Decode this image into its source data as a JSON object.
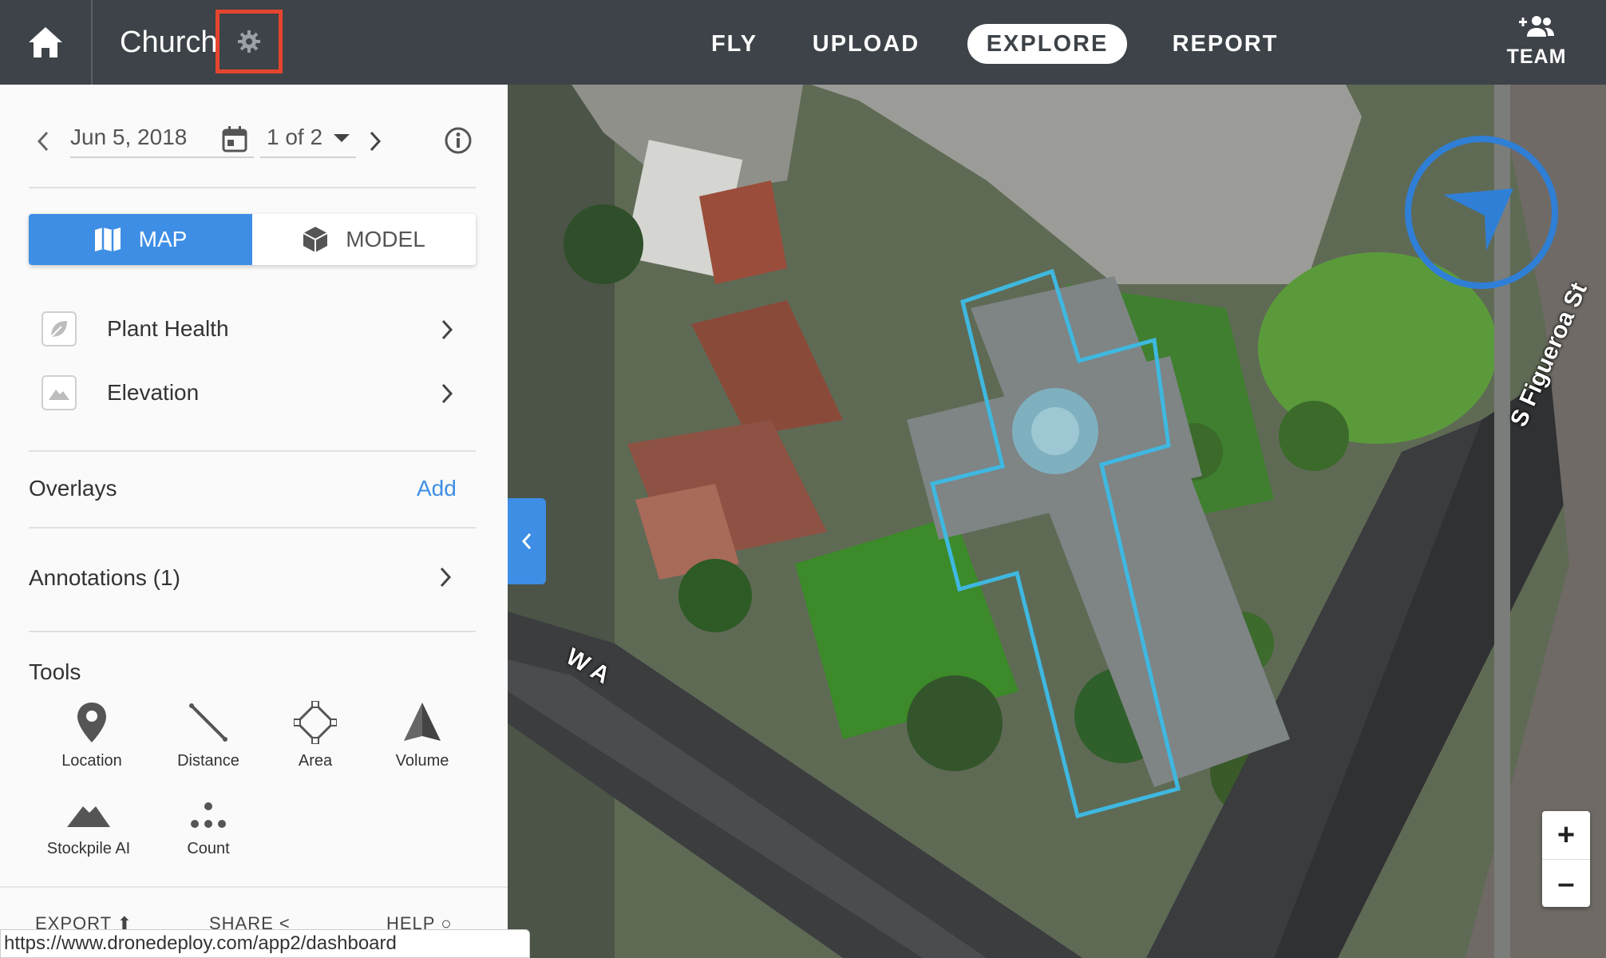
{
  "header": {
    "project_title": "Church",
    "nav": {
      "fly": "FLY",
      "upload": "UPLOAD",
      "explore": "EXPLORE",
      "report": "REPORT"
    },
    "team_label": "TEAM"
  },
  "sidebar": {
    "date": "Jun 5, 2018",
    "map_count": "1 of 2",
    "view_toggle": {
      "map": "MAP",
      "model": "MODEL",
      "active": "MAP"
    },
    "layers": [
      {
        "label": "Plant Health",
        "icon": "leaf-icon"
      },
      {
        "label": "Elevation",
        "icon": "mountain-icon"
      }
    ],
    "overlays": {
      "label": "Overlays",
      "add": "Add"
    },
    "annotations": {
      "label": "Annotations (1)"
    },
    "tools_heading": "Tools",
    "tools": [
      {
        "label": "Location",
        "icon": "pin-icon"
      },
      {
        "label": "Distance",
        "icon": "ruler-line-icon"
      },
      {
        "label": "Area",
        "icon": "polygon-icon"
      },
      {
        "label": "Volume",
        "icon": "pyramid-icon"
      },
      {
        "label": "Stockpile AI",
        "icon": "stockpile-icon"
      },
      {
        "label": "Count",
        "icon": "dots-icon"
      }
    ],
    "footer": {
      "export": "EXPORT",
      "share": "SHARE",
      "help": "HELP"
    }
  },
  "map": {
    "street_labels": [
      "S Figueroa St",
      "W A"
    ]
  },
  "status_url": "https://www.dronedeploy.com/app2/dashboard",
  "colors": {
    "accent": "#3e8ee5",
    "header_bg": "#3d4348",
    "highlight": "#e5452f",
    "outline": "#3fb8e0"
  }
}
